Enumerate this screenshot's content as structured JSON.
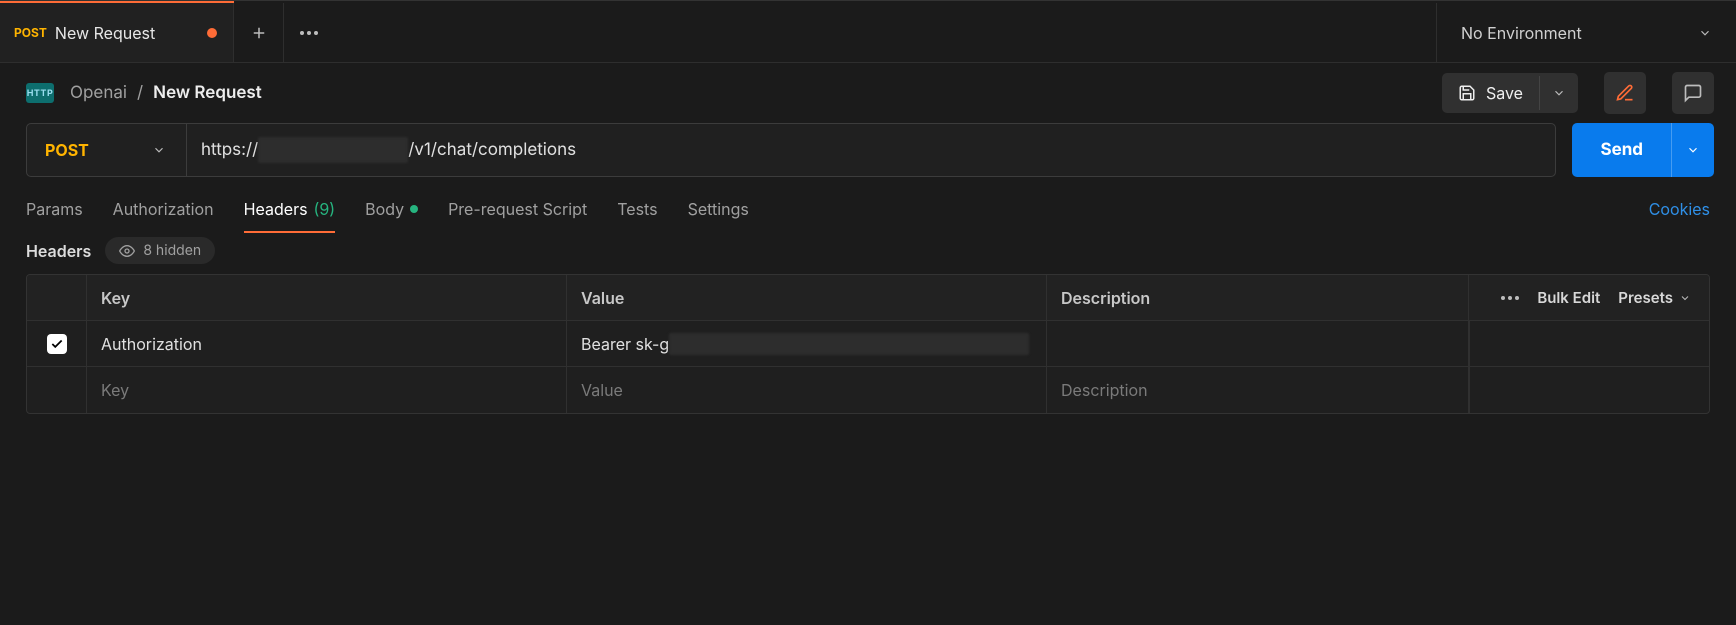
{
  "tab": {
    "method": "POST",
    "title": "New Request"
  },
  "environment": {
    "label": "No Environment"
  },
  "breadcrumb": {
    "workspace": "Openai",
    "sep": "/",
    "current": "New Request"
  },
  "toolbar": {
    "save_label": "Save"
  },
  "request": {
    "method": "POST",
    "url_prefix": "https://",
    "url_suffix": "/v1/chat/completions",
    "send_label": "Send"
  },
  "tabs": {
    "params": "Params",
    "authorization": "Authorization",
    "headers": "Headers",
    "headers_count": "(9)",
    "body": "Body",
    "prerequest": "Pre-request Script",
    "tests": "Tests",
    "settings": "Settings",
    "cookies": "Cookies"
  },
  "headers_section": {
    "title": "Headers",
    "hidden_label": "8 hidden"
  },
  "headers_table": {
    "col_key": "Key",
    "col_value": "Value",
    "col_desc": "Description",
    "bulk_edit": "Bulk Edit",
    "presets": "Presets",
    "rows": [
      {
        "checked": true,
        "key": "Authorization",
        "value_prefix": "Bearer sk-g",
        "description": ""
      }
    ],
    "placeholder_key": "Key",
    "placeholder_value": "Value",
    "placeholder_desc": "Description"
  }
}
